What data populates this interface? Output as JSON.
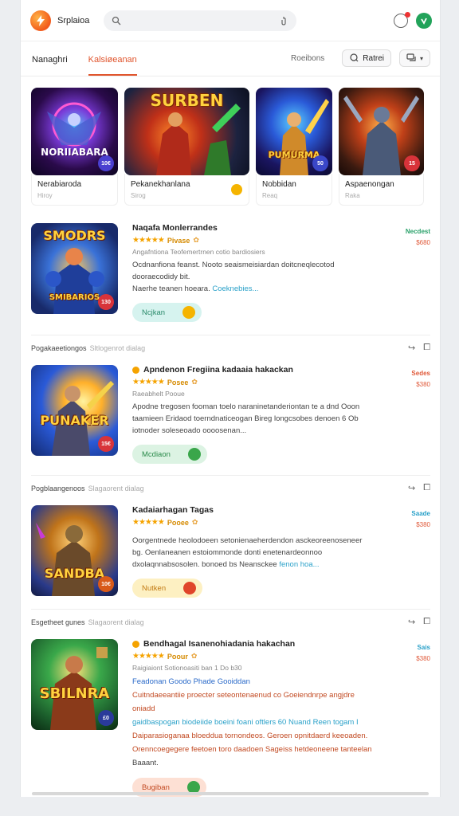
{
  "header": {
    "brand": "Srplaioa",
    "search_placeholder": ""
  },
  "tabs": {
    "items": [
      {
        "label": "Nanaghri"
      },
      {
        "label": "Kalsiøeanan"
      }
    ],
    "right_link": "Roeibons",
    "filter_label": "Ratrei"
  },
  "featured": [
    {
      "art": "NORIIABARA",
      "name": "Nerabiaroda",
      "sub": "Hiroy",
      "price": "10€",
      "price_color": "#4a3fd0"
    },
    {
      "art": "SURBEN",
      "name": "Pekanekhanlana",
      "sub": "Sirog",
      "price": "",
      "price_color": "#f5b400"
    },
    {
      "art": "PUMURMA",
      "name": "Nobbidan",
      "sub": "Reaq",
      "price": "50",
      "price_color": "#3a47c8"
    },
    {
      "art": "",
      "name": "Aspaenongan",
      "sub": "Raka",
      "price": "15",
      "price_color": "#d8333a"
    }
  ],
  "items": [
    {
      "section": "",
      "section_sub": "",
      "art": "SMODRS",
      "art_bottom": "SMIBARIOS",
      "title": "Naqafa Monlerrandes",
      "rating_tag": "Pivase",
      "meta": "Angafntiona   Teofemertrnen cotio bardiosiers",
      "desc": "Ocdnanfiona feanst. Nooto seaismeisiardan doitcneqlecotod dooraecodidy bit.",
      "desc2": "Naerhe teanen hoeara.",
      "desc_link": "Coeknebies...",
      "action": "Ncjkan",
      "side_top": "Necdest",
      "side_bottom": "$680",
      "price": "130"
    },
    {
      "section": "Pogakaeetiongos",
      "section_sub": "Sltlogenrot dialag",
      "art": "PUNAKER",
      "art_bottom": "",
      "title": "Apndenon Fregiina kadaaia hakackan",
      "rating_tag": "Posee",
      "meta": "Raeabhelt   Pooue",
      "desc": "Apodne tregosen fooman toelo naraninetanderiontan te a dnd Ooon taamieen Eridaod toerndnaticeogan Bireg longcsobes denoen 6 Ob iotnoder soleseoado oooosenan...",
      "desc2": "",
      "desc_link": "",
      "action": "Mcdiaon",
      "side_top": "Sedes",
      "side_bottom": "$380",
      "price": "15€"
    },
    {
      "section": "Pogblaangenoos",
      "section_sub": "Slagaorent dialag",
      "art": "SANDBA",
      "art_bottom": "",
      "title": "Kadaiarhagan Tagas",
      "rating_tag": "Pooee",
      "meta": "",
      "desc": "Oorgentnede heolodoeen setonienaeherdendon asckeoreenoseneer bg. Oenlaneanen estoiommonde donti enetenardeonnoo dxolaqnnabsosolen. bonoed bs Neansckee",
      "desc2": "",
      "desc_link": "fenon hoa...",
      "action": "Nutken",
      "side_top": "Saade",
      "side_bottom": "$380",
      "price": "10€"
    },
    {
      "section": "Esgetheet gunes",
      "section_sub": "Slagaorent dialag",
      "art": "SBILNRA",
      "art_bottom": "",
      "title": "Bendhagal Isanenohiadania hakachan",
      "rating_tag": "Poour",
      "meta": "Raigiaiont   Sotionoasiti ban 1 Do b30",
      "offer_head": "Feadonan Goodo   Phade Gooiddan",
      "offer_lines": [
        "Cuitndaeeantiie proecter seteontenaenud co Goeiendnrpe angjdre oniadd",
        "gaidbaspogan biodeiide boeini foani oftlers 60 Nuand Reen togam I",
        "Daiparasioganaa bloeddua tornondeos. Geroen opnitdaerd keeoaden.",
        "Orenncoegegere feetoen toro daadoen Sageiss hetdeoneene tanteelan",
        "Baaant."
      ],
      "action": "Bugiban",
      "side_top": "Sais",
      "side_bottom": "$380",
      "price": "£0"
    }
  ],
  "colors": {
    "accent": "#e0542c",
    "star": "#f5a300",
    "link": "#2aa1c9"
  }
}
